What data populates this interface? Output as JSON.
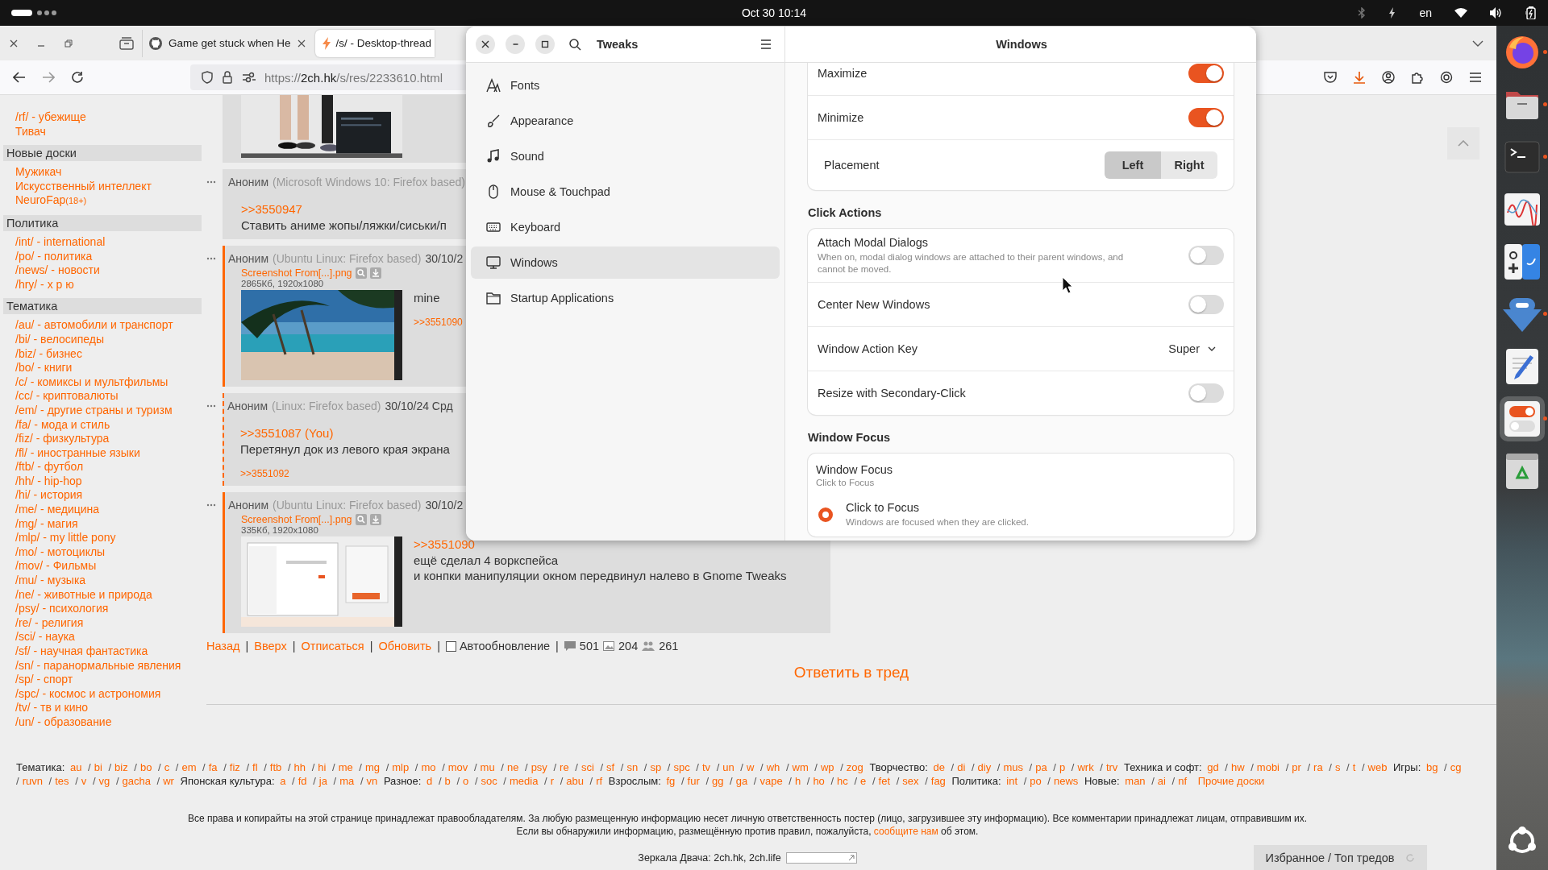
{
  "topbar": {
    "clock": "Oct 30  10:14",
    "language": "en"
  },
  "browser": {
    "tabs": [
      {
        "title": "Game get stuck when He",
        "kind": "github",
        "selected": false
      },
      {
        "title": "/s/ - Desktop-thread",
        "kind": "bolt",
        "selected": true
      }
    ],
    "url": {
      "scheme": "https://",
      "host": "2ch.hk",
      "path": "/s/res/2233610.html"
    }
  },
  "sidebar": {
    "groups": [
      {
        "links": [
          {
            "text": "/rf/ - убежище"
          },
          {
            "text": "Тивач"
          }
        ]
      },
      {
        "title": "Новые доски",
        "links": [
          {
            "text": "Мужикач"
          },
          {
            "text": "Искусственный интеллект"
          },
          {
            "text": "NeuroFap",
            "note": "(18+)"
          }
        ]
      },
      {
        "title": "Политика",
        "links": [
          {
            "text": "/int/ - international"
          },
          {
            "text": "/po/ - политика"
          },
          {
            "text": "/news/ - новости"
          },
          {
            "text": "/hry/ - х р ю"
          }
        ]
      },
      {
        "title": "Тематика",
        "links": [
          {
            "text": "/au/ - автомобили и транспорт"
          },
          {
            "text": "/bi/ - велосипеды"
          },
          {
            "text": "/biz/ - бизнес"
          },
          {
            "text": "/bo/ - книги"
          },
          {
            "text": "/c/ - комиксы и мультфильмы"
          },
          {
            "text": "/cc/ - криптовалюты"
          },
          {
            "text": "/em/ - другие страны и туризм"
          },
          {
            "text": "/fa/ - мода и стиль"
          },
          {
            "text": "/fiz/ - физкультура"
          },
          {
            "text": "/fl/ - иностранные языки"
          },
          {
            "text": "/ftb/ - футбол"
          },
          {
            "text": "/hh/ - hip-hop"
          },
          {
            "text": "/hi/ - история"
          },
          {
            "text": "/me/ - медицина"
          },
          {
            "text": "/mg/ - магия"
          },
          {
            "text": "/mlp/ - my little pony"
          },
          {
            "text": "/mo/ - мотоциклы"
          },
          {
            "text": "/mov/ - Фильмы"
          },
          {
            "text": "/mu/ - музыка"
          },
          {
            "text": "/ne/ - животные и природа"
          },
          {
            "text": "/psy/ - психология"
          },
          {
            "text": "/re/ - религия"
          },
          {
            "text": "/sci/ - наука"
          },
          {
            "text": "/sf/ - научная фантастика"
          },
          {
            "text": "/sn/ - паранормальные явления"
          },
          {
            "text": "/sp/ - спорт"
          },
          {
            "text": "/spc/ - космос и астрономия"
          },
          {
            "text": "/tv/ - тв и кино"
          },
          {
            "text": "/un/ - образование"
          }
        ]
      }
    ]
  },
  "posts": [
    {
      "kind": "plain",
      "image": {
        "kind": "picture"
      }
    },
    {
      "kind": "plain",
      "name": "Аноним",
      "client": "(Microsoft Windows 10: Firefox based)",
      "quote": ">>3550947",
      "lines": [
        "Ставить аниме жопы/ляжки/сиськи/п"
      ]
    },
    {
      "kind": "reply",
      "name": "Аноним",
      "client": "(Ubuntu Linux: Firefox based)",
      "date": "30/10/2",
      "file": {
        "name": "Screenshot From[...].png",
        "info": "2865Кб, 1920x1080"
      },
      "image": {
        "kind": "picture"
      },
      "lines": [
        "mine"
      ],
      "replies": [
        ">>3551090"
      ]
    },
    {
      "kind": "own",
      "name": "Аноним",
      "client": "(Linux: Firefox based)",
      "date": "30/10/24 Срд",
      "quote": ">>3551087 (You)",
      "lines": [
        "Перетянул док из левого края экрана"
      ],
      "replies": [
        ">>3551092"
      ]
    },
    {
      "kind": "reply",
      "name": "Аноним",
      "client": "(Ubuntu Linux: Firefox based)",
      "date": "30/10/2",
      "file": {
        "name": "Screenshot From[...].png",
        "info": "335Кб, 1920x1080"
      },
      "image": {
        "kind": "picture"
      },
      "quote": ">>3551090",
      "lines": [
        "ещё сделал 4 воркспейса",
        "и конпки манипуляции окном передвинул налево в Gnome Tweaks"
      ]
    }
  ],
  "thread_nav": {
    "links": [
      "Назад",
      "Вверх",
      "Отписаться",
      "Обновить"
    ],
    "separator": "|",
    "autoupdate": {
      "label": "Автообновление",
      "checked": false
    },
    "counts": {
      "posts": "501",
      "images": "204",
      "posters": "261"
    }
  },
  "reply_link": "Ответить в тред",
  "footer": {
    "separator": "/",
    "board_groups": [
      {
        "label": "Тематика:",
        "boards": [
          "au",
          "bi",
          "biz",
          "bo",
          "c",
          "em",
          "fa",
          "fiz",
          "fl",
          "ftb",
          "hh",
          "hi",
          "me",
          "mg",
          "mlp",
          "mo",
          "mov",
          "mu",
          "ne",
          "psy",
          "re",
          "sci",
          "sf",
          "sn",
          "sp",
          "spc",
          "tv",
          "un",
          "w",
          "wh",
          "wm",
          "wp",
          "zog"
        ]
      },
      {
        "label": "Творчество:",
        "boards": [
          "de",
          "di",
          "diy",
          "mus",
          "pa",
          "p",
          "wrk",
          "trv"
        ]
      },
      {
        "label": "Техника и софт:",
        "boards": [
          "gd",
          "hw",
          "mobi",
          "pr",
          "ra",
          "s",
          "t",
          "web"
        ]
      },
      {
        "label": "Игры:",
        "boards": [
          "bg",
          "cg",
          "ruvn",
          "tes",
          "v",
          "vg",
          "gacha",
          "wr"
        ]
      },
      {
        "label": "Японская культура:",
        "boards": [
          "a",
          "fd",
          "ja",
          "ma",
          "vn"
        ]
      },
      {
        "label": "Разное:",
        "boards": [
          "d",
          "b",
          "o",
          "soc",
          "media",
          "r",
          "abu",
          "rf"
        ]
      },
      {
        "label": "Взрослым:",
        "boards": [
          "fg",
          "fur",
          "gg",
          "ga",
          "vape",
          "h",
          "ho",
          "hc",
          "e",
          "fet",
          "sex",
          "fag"
        ]
      },
      {
        "label": "Политика:",
        "boards": [
          "int",
          "po",
          "news"
        ]
      },
      {
        "label": "Новые:",
        "boards": [
          "man",
          "ai",
          "nf"
        ]
      }
    ],
    "other_boards": "Прочие доски",
    "copyright": "Все права и копирайты на этой странице принадлежат правообладателям. За любую размещенную информацию несет личную ответственность постер (лицо, загрузившее эту информацию). Все комментарии принадлежат лицам, отправившим их.",
    "report": {
      "before": "Если вы обнаружили информацию, размещённую против правил, пожалуйста,",
      "link": "сообщите нам",
      "after": "об этом."
    },
    "mirrors": "Зеркала Двача: 2ch.hk, 2ch.life",
    "favorites_button": "Избранное / Топ тредов"
  },
  "tweaks": {
    "title": "Tweaks",
    "page_title": "Windows",
    "nav": [
      {
        "label": "Fonts",
        "selected": false
      },
      {
        "label": "Appearance",
        "selected": false
      },
      {
        "label": "Sound",
        "selected": false
      },
      {
        "label": "Mouse & Touchpad",
        "selected": false
      },
      {
        "label": "Keyboard",
        "selected": false
      },
      {
        "label": "Windows",
        "selected": true
      },
      {
        "label": "Startup Applications",
        "selected": false
      }
    ],
    "titlebar_buttons": [
      {
        "label": "Maximize",
        "on": true
      },
      {
        "label": "Minimize",
        "on": true
      }
    ],
    "placement": {
      "label": "Placement",
      "options": [
        {
          "label": "Left",
          "selected": true
        },
        {
          "label": "Right",
          "selected": false
        }
      ]
    },
    "click_actions": {
      "heading": "Click Actions",
      "rows": [
        {
          "kind": "switch",
          "label": "Attach Modal Dialogs",
          "description": "When on, modal dialog windows are attached to their parent windows, and cannot be moved.",
          "on": false
        },
        {
          "kind": "switch",
          "label": "Center New Windows",
          "on": false
        },
        {
          "kind": "dropdown",
          "label": "Window Action Key",
          "value": "Super"
        },
        {
          "kind": "switch",
          "label": "Resize with Secondary-Click",
          "on": false
        }
      ]
    },
    "window_focus": {
      "heading": "Window Focus",
      "title": "Window Focus",
      "subtitle": "Click to Focus",
      "options": [
        {
          "label": "Click to Focus",
          "description": "Windows are focused when they are clicked.",
          "selected": true
        }
      ]
    }
  },
  "dock": {
    "apps": [
      {
        "kind": "firefox",
        "running": true,
        "selected": false
      },
      {
        "kind": "files",
        "running": true,
        "selected": false
      },
      {
        "kind": "terminal",
        "running": true,
        "selected": false
      },
      {
        "kind": "monitor",
        "running": false,
        "selected": false
      },
      {
        "kind": "input",
        "running": false,
        "selected": false
      },
      {
        "kind": "arrow",
        "running": true,
        "selected": false
      },
      {
        "kind": "editor",
        "running": false,
        "selected": false
      },
      {
        "kind": "tweaks",
        "running": true,
        "selected": true
      },
      {
        "kind": "trash",
        "running": false,
        "selected": false
      }
    ]
  }
}
